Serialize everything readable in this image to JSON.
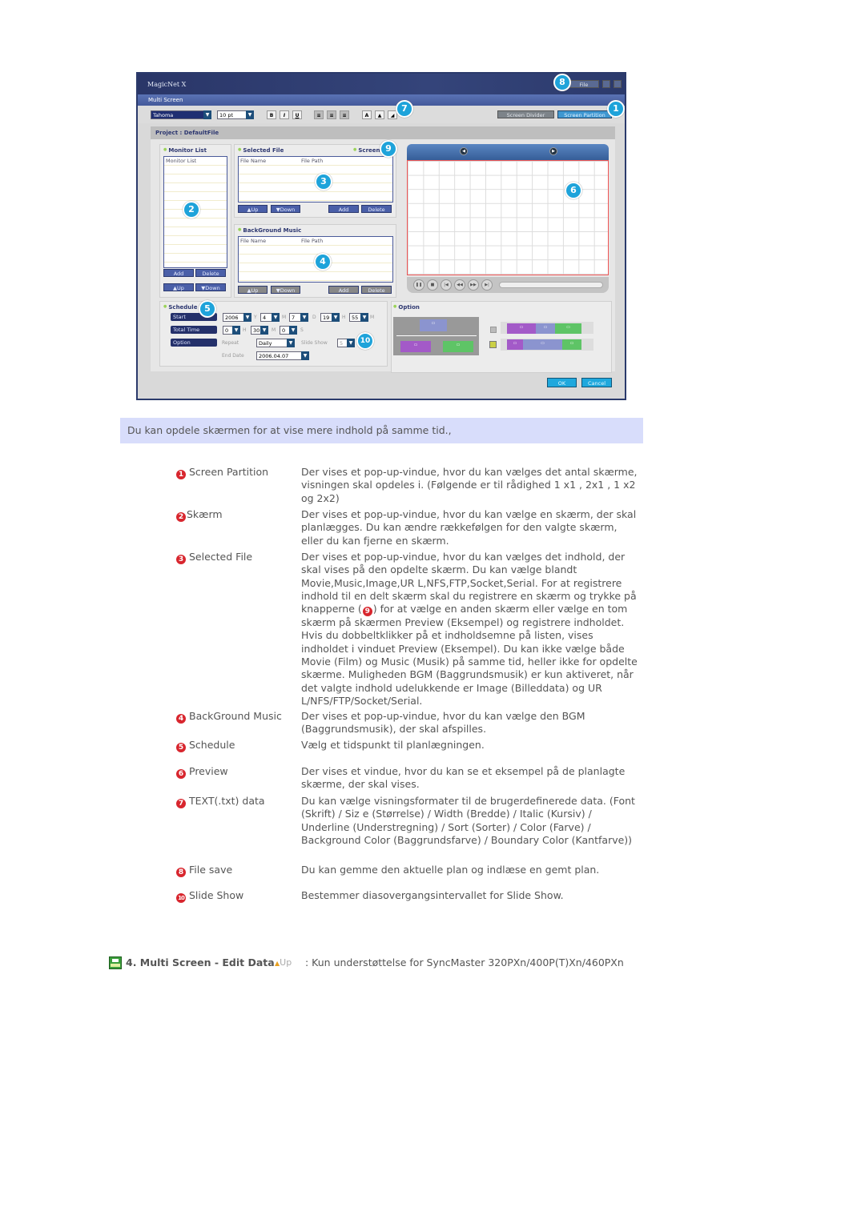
{
  "app": {
    "logo": "MagicNet X",
    "window_title": "Multi Screen",
    "file_menu": "File",
    "font_value": "Tahoma",
    "size_value": "10 pt",
    "bold": "B",
    "italic": "I",
    "underline": "U",
    "screen_divider": "Screen Divider",
    "screen_partition": "Screen Partition",
    "project": "Project : DefaultFile",
    "monitor_list": {
      "title": "Monitor List",
      "header": "Monitor List",
      "add": "Add",
      "delete": "Delete",
      "up": "▲Up",
      "down": "▼Down"
    },
    "selected_file": {
      "title": "Selected File",
      "screen": "Screen 1",
      "col1": "File Name",
      "col2": "File Path",
      "up": "▲Up",
      "down": "▼Down",
      "add": "Add",
      "delete": "Delete"
    },
    "bgm": {
      "title": "BackGround Music",
      "col1": "File Name",
      "col2": "File Path",
      "up": "▲Up",
      "down": "▼Down",
      "add": "Add",
      "delete": "Delete"
    },
    "schedule": {
      "title": "Schedule",
      "start": "Start",
      "total_time": "Total Time",
      "option": "Option",
      "year": "2006",
      "y": "Y",
      "month": "4",
      "m": "M",
      "day": "7",
      "d": "D",
      "hour": "19",
      "h": "H",
      "minute": "55",
      "mi": "M",
      "tt_h": "0",
      "tt_hl": "H",
      "tt_m": "30",
      "tt_ml": "M",
      "tt_s": "0",
      "tt_sl": "S",
      "repeat_label": "Repeat",
      "repeat": "Daily",
      "slide_label": "Slide Show",
      "slide": "5",
      "end_label": "End Date",
      "end_date": "2006.04.07"
    },
    "option_title": "Option",
    "ok": "OK",
    "cancel": "Cancel",
    "callouts": [
      "1",
      "2",
      "3",
      "4",
      "5",
      "6",
      "7",
      "8",
      "9",
      "10"
    ]
  },
  "caption": "Du kan opdele skærmen for at vise mere indhold på samme tid.,",
  "items": [
    {
      "num": "1",
      "label": "Screen Partition",
      "desc": "Der vises et pop-up-vindue, hvor du kan vælges det antal skærme, visningen skal opdeles i. (Følgende er til rådighed 1 x1 , 2x1 , 1 x2 og 2x2)"
    },
    {
      "num": "2",
      "label": "Skærm",
      "desc": "Der vises et pop-up-vindue, hvor du kan vælge en skærm, der skal planlægges. Du kan ændre rækkefølgen for den valgte skærm, eller du kan fjerne en skærm."
    },
    {
      "num": "3",
      "label": "Selected File",
      "desc_before": "Der vises et pop-up-vindue, hvor du kan vælges det indhold, der skal vises på den opdelte skærm. Du kan vælge blandt Movie,Music,Image,UR L,NFS,FTP,Socket,Serial. For at registrere indhold til en delt skærm skal du registrere en skærm og trykke på knapperne (",
      "desc_ref": "9",
      "desc_after": ") for at vælge en anden skærm eller vælge en tom skærm på skærmen Preview (Eksempel) og registrere indholdet. Hvis du dobbeltklikker på et indholdsemne på listen, vises indholdet i vinduet Preview (Eksempel). Du kan ikke vælge både Movie (Film) og Music (Musik) på samme tid, heller ikke for opdelte skærme. Muligheden BGM (Baggrundsmusik) er kun aktiveret, når det valgte indhold udelukkende er Image (Billeddata) og UR L/NFS/FTP/Socket/Serial."
    },
    {
      "num": "4",
      "label": "BackGround Music",
      "desc": "Der vises et pop-up-vindue, hvor du kan vælge den BGM (Baggrundsmusik), der skal afspilles."
    },
    {
      "num": "5",
      "label": "Schedule",
      "desc": "Vælg et tidspunkt til planlægningen."
    },
    {
      "num": "6",
      "label": "Preview",
      "desc": "Der vises et vindue, hvor du kan se et eksempel på de planlagte skærme, der skal vises."
    },
    {
      "num": "7",
      "label": "TEXT(.txt) data",
      "desc": "Du kan vælge visningsformater til de brugerdefinerede data. (Font (Skrift) / Siz e (Størrelse) / Width (Bredde) / Italic (Kursiv) / Underline (Understregning) / Sort (Sorter) / Color (Farve) / Background Color (Baggrundsfarve) / Boundary Color (Kantfarve))"
    },
    {
      "num": "8",
      "label": "File save",
      "desc": "Du kan gemme den aktuelle plan og indlæse en gemt plan."
    },
    {
      "num": "10",
      "label": "Slide Show",
      "desc": "Bestemmer diasovergangsintervallet for Slide Show."
    }
  ],
  "footer": {
    "title": "4. Multi Screen - Edit Data",
    "up": "Up",
    "note": ": Kun understøttelse for SyncMaster 320PXn/400P(T)Xn/460PXn"
  },
  "colors": {
    "caption_bg": "#d8ddfb",
    "callout": "#1ea3da",
    "item_number": "#d8262e",
    "text": "#555555"
  }
}
